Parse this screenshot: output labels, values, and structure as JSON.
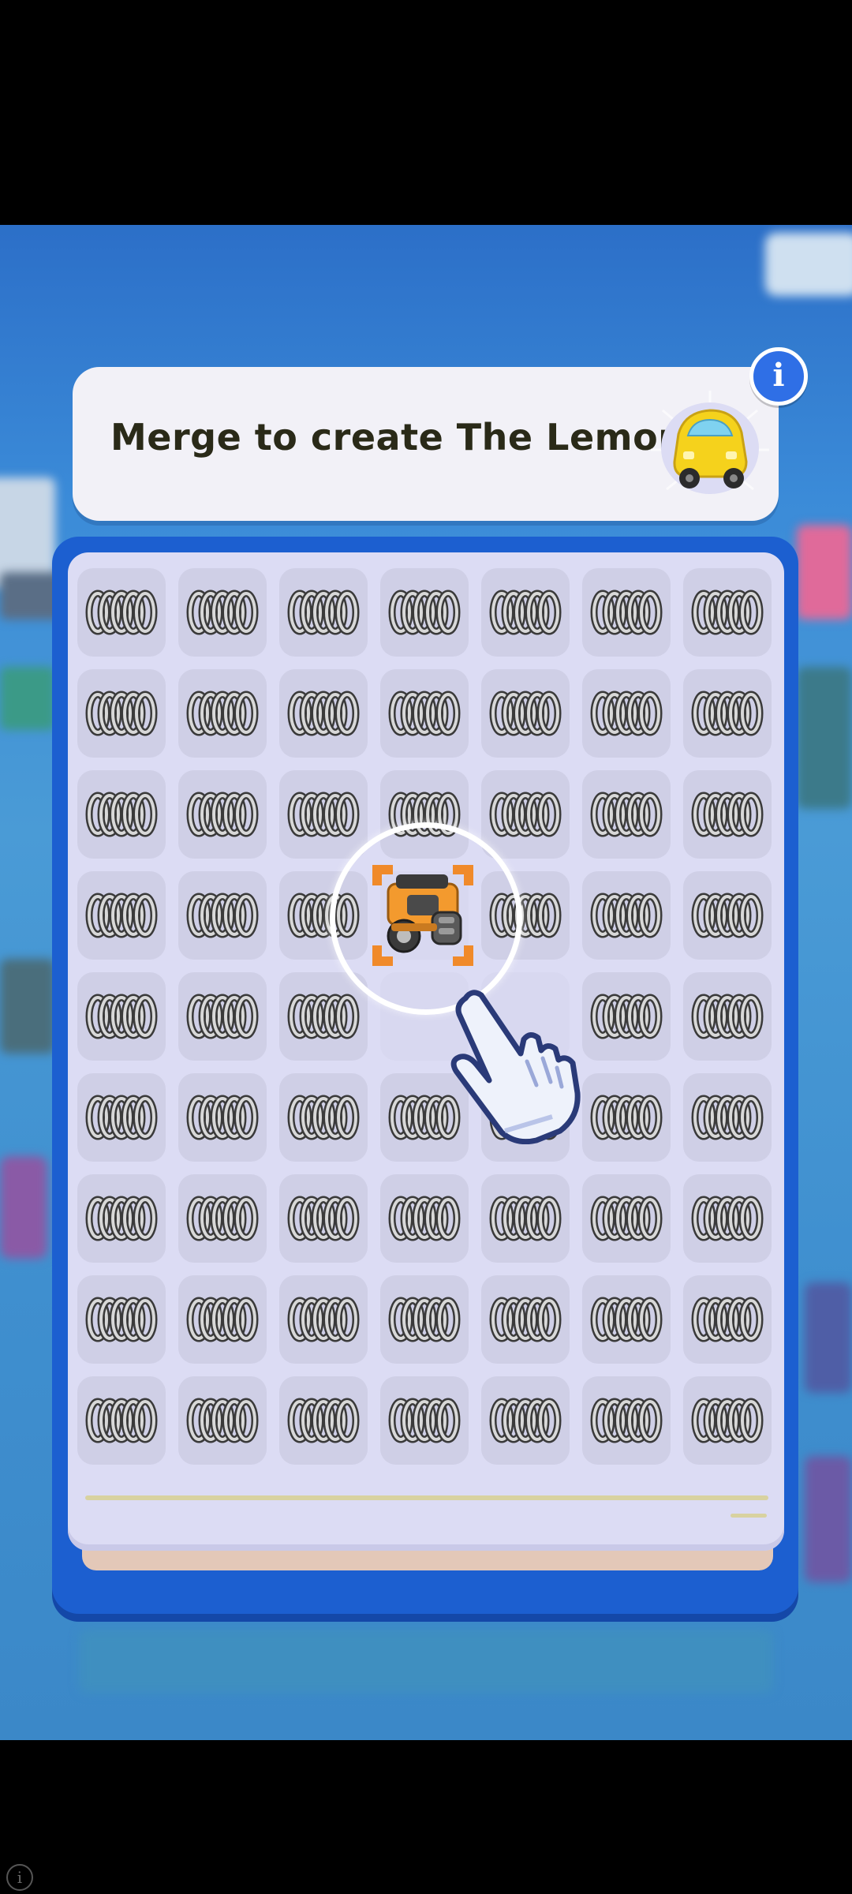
{
  "banner": {
    "text": "Merge to create The Lemon!",
    "info_label": "i"
  },
  "board": {
    "columns": 7,
    "rows": 9,
    "item": "spring-icon",
    "empty_cells": [
      [
        4,
        3
      ],
      [
        4,
        4
      ]
    ],
    "engine_cell": [
      3,
      3
    ]
  },
  "colors": {
    "board_blue": "#1c5fd0",
    "board_inner": "#dcdcf4",
    "info_blue": "#2f6fe6",
    "lemon_yellow": "#f5d21c",
    "engine_orange": "#f39a2e"
  },
  "system": {
    "corner_info_label": "i"
  }
}
